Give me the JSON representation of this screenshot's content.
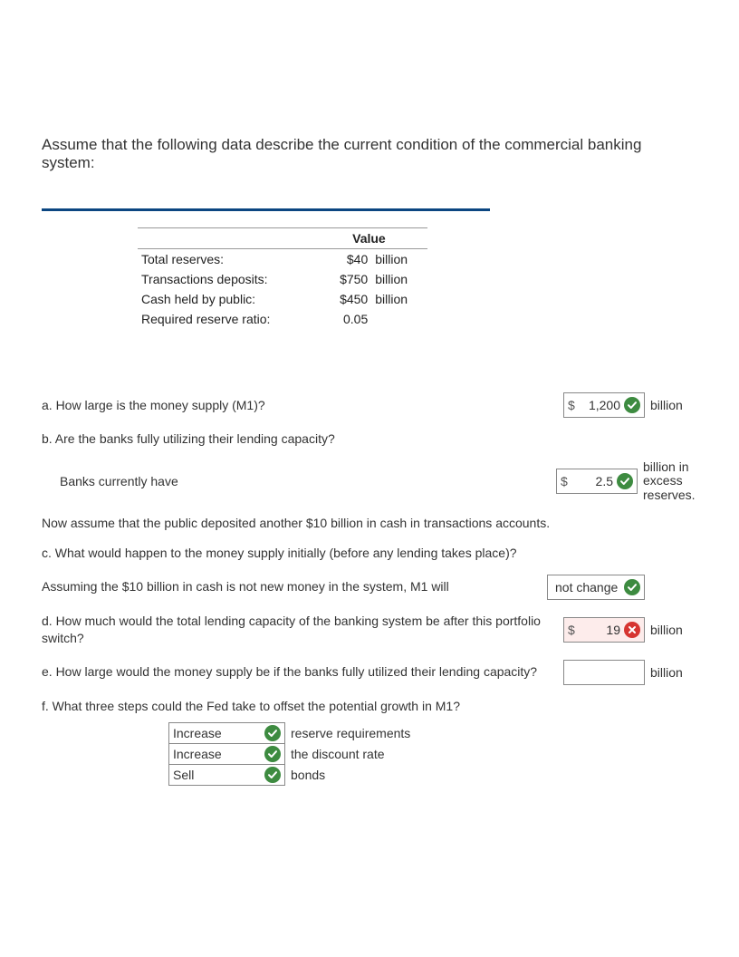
{
  "intro": "Assume that the following data describe the current condition of the commercial banking system:",
  "table": {
    "header_value": "Value",
    "rows": [
      {
        "label": "Total reserves:",
        "amount": "$40",
        "unit": "billion"
      },
      {
        "label": "Transactions deposits:",
        "amount": "$750",
        "unit": "billion"
      },
      {
        "label": "Cash held by public:",
        "amount": "$450",
        "unit": "billion"
      },
      {
        "label": "Required reserve ratio:",
        "amount": "0.05",
        "unit": ""
      }
    ]
  },
  "q": {
    "a_text": "a. How large is the money supply (M1)?",
    "a_dollar": "$",
    "a_value": "1,200",
    "a_suffix": "billion",
    "b_text": "b. Are the banks fully utilizing their lending capacity?",
    "b_indent_text": "Banks currently have",
    "b_dollar": "$",
    "b_value": "2.5",
    "b_suffix": "billion in excess reserves.",
    "assume_text": "Now assume that the public deposited another $10 billion in cash in transactions accounts.",
    "c_text": "c. What would happen to the money supply initially (before any lending takes place)?",
    "c_line2": "Assuming the $10 billion in cash is not new money in the system, M1 will",
    "c_value": "not change",
    "d_text": "d. How much would the total lending capacity of the banking system be after this portfolio switch?",
    "d_dollar": "$",
    "d_value": "19",
    "d_suffix": "billion",
    "e_text": "e. How large would the money supply be if the banks fully utilized their lending capacity?",
    "e_suffix": "billion",
    "f_text": "f. What three steps could the Fed take to offset the potential growth in M1?",
    "f_rows": [
      {
        "value": "Increase",
        "label": "reserve requirements"
      },
      {
        "value": "Increase",
        "label": "the discount rate"
      },
      {
        "value": "Sell",
        "label": "bonds"
      }
    ]
  }
}
